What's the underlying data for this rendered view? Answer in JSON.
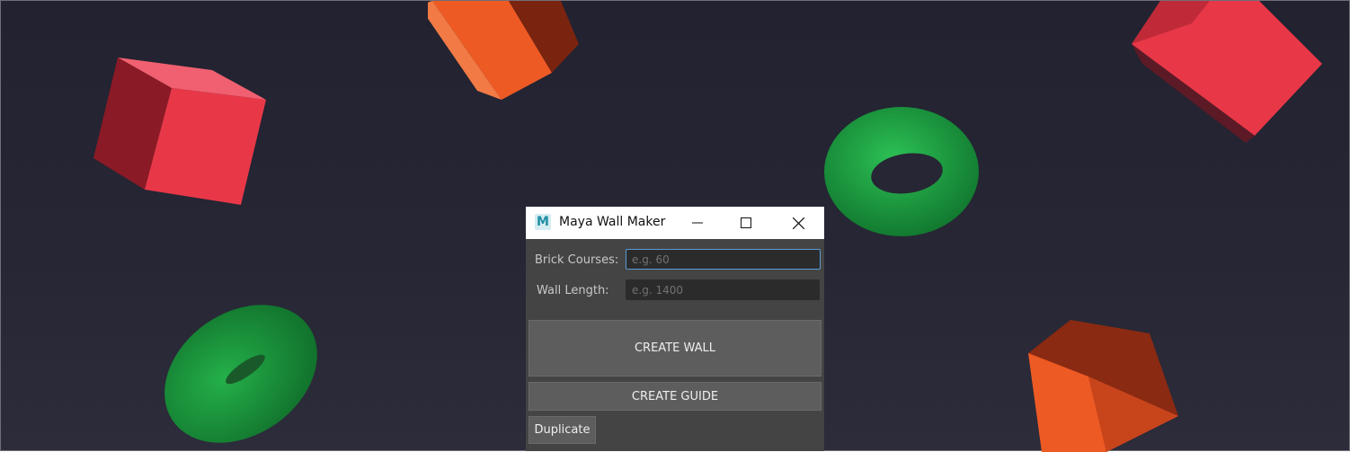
{
  "window": {
    "title": "Maya Wall Maker",
    "app_icon_glyph": "M",
    "controls": [
      "minimize-icon",
      "maximize-icon",
      "close-icon"
    ]
  },
  "form": {
    "brick_courses": {
      "label": "Brick Courses:",
      "value": "",
      "placeholder": "e.g. 60"
    },
    "wall_length": {
      "label": "Wall Length:",
      "value": "",
      "placeholder": "e.g. 1400"
    }
  },
  "buttons": {
    "create_wall": "CREATE WALL",
    "create_guide": "CREATE GUIDE",
    "duplicate": "Duplicate"
  },
  "scene": {
    "background": "#242432",
    "objects": [
      "red-cube",
      "orange-box",
      "green-torus",
      "green-torus",
      "red-cube",
      "orange-box"
    ]
  },
  "colors": {
    "cube_red": "#e83848",
    "box_orange": "#ee5a24",
    "torus_green": "#1ea845",
    "focus_border": "#5b9bd6"
  }
}
